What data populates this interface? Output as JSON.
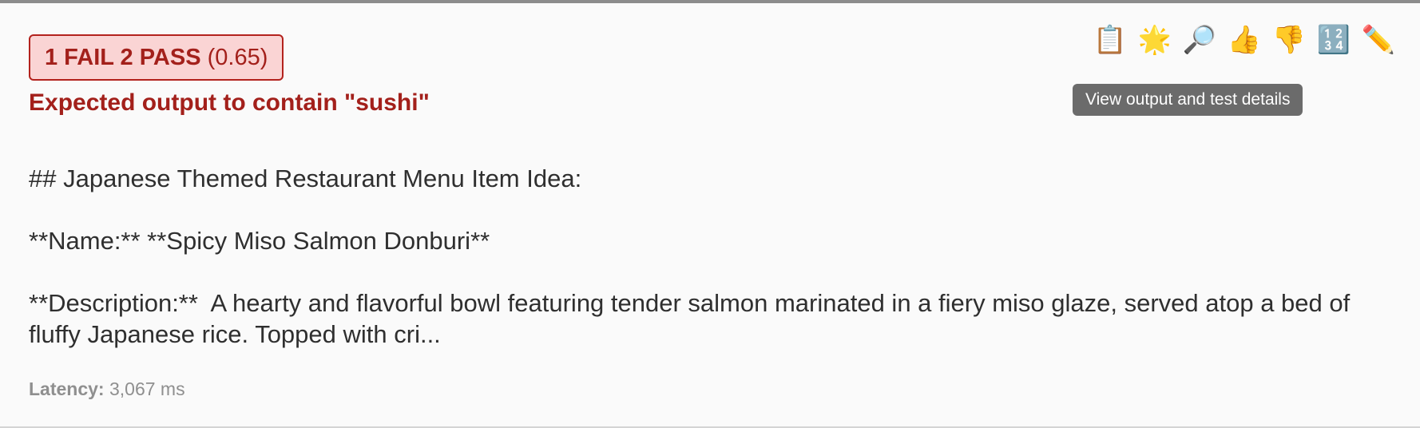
{
  "result": {
    "status_label": "1 FAIL 2 PASS",
    "score": "(0.65)",
    "fail_reason": "Expected output to contain \"sushi\""
  },
  "actions": [
    {
      "icon": "clipboard-icon",
      "glyph": "📋"
    },
    {
      "icon": "star-icon",
      "glyph": "🌟"
    },
    {
      "icon": "magnifier-icon",
      "glyph": "🔎"
    },
    {
      "icon": "thumbs-up-icon",
      "glyph": "👍"
    },
    {
      "icon": "thumbs-down-icon",
      "glyph": "👎"
    },
    {
      "icon": "numbers-icon",
      "glyph": "🔢"
    },
    {
      "icon": "pencil-icon",
      "glyph": "✏️"
    }
  ],
  "tooltip": "View output and test details",
  "output": {
    "heading": "## Japanese Themed Restaurant Menu Item Idea:",
    "name_line": "**Name:** **Spicy Miso Salmon Donburi**",
    "description": "**Description:**  A hearty and flavorful bowl featuring tender salmon marinated in a fiery miso glaze, served atop a bed of fluffy Japanese rice. Topped with cri..."
  },
  "latency": {
    "label": "Latency:",
    "value": "3,067 ms"
  },
  "colors": {
    "fail_text": "#a3201b",
    "fail_bg": "#fad4d4",
    "tooltip_bg": "#6b6b6b"
  }
}
